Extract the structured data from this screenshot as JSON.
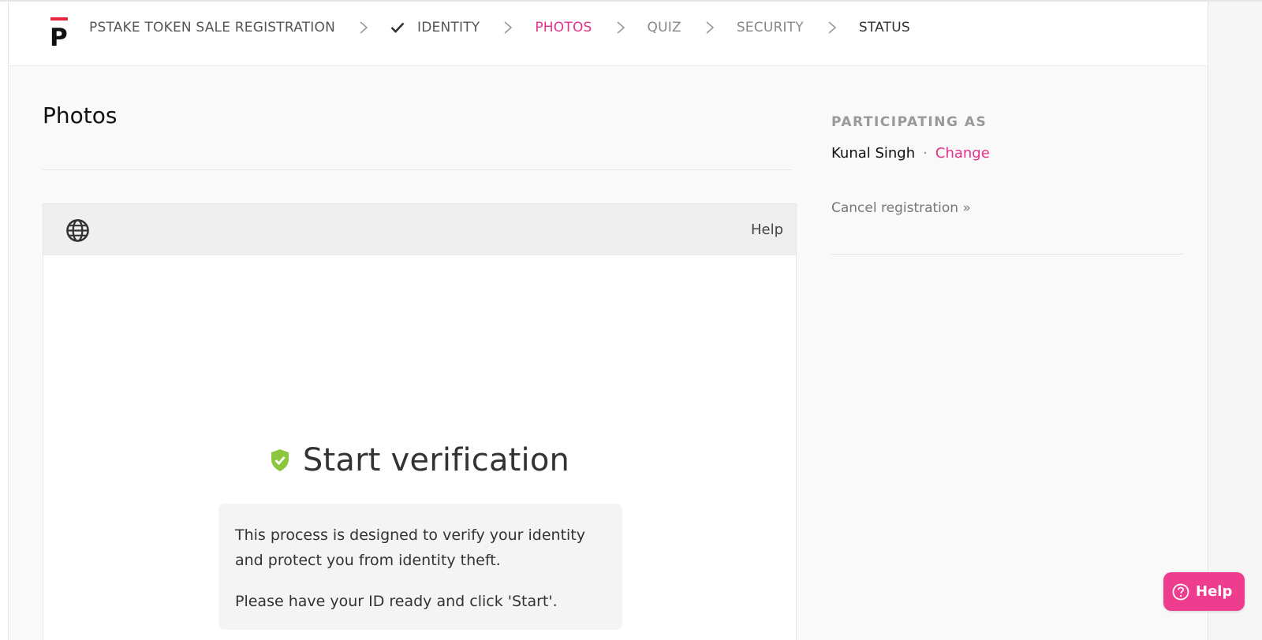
{
  "header": {
    "brand_letter": "P",
    "steps": [
      {
        "label": "PSTAKE TOKEN SALE REGISTRATION"
      },
      {
        "label": "IDENTITY",
        "completed": true
      },
      {
        "label": "PHOTOS",
        "active": true
      },
      {
        "label": "QUIZ"
      },
      {
        "label": "SECURITY"
      },
      {
        "label": "STATUS"
      }
    ]
  },
  "main": {
    "title": "Photos",
    "widget": {
      "language_icon": "globe-icon",
      "help_label": "Help",
      "heading": "Start verification",
      "heading_icon": "shield-check-icon",
      "body_line_1": "This process is designed to verify your identity and protect you from identity theft.",
      "body_line_2": "Please have your ID ready and click 'Start'."
    }
  },
  "sidebar": {
    "heading": "PARTICIPATING AS",
    "user_name": "Kunal Singh",
    "separator": "·",
    "change_label": "Change",
    "cancel_label": "Cancel registration »"
  },
  "help_fab": {
    "label": "Help",
    "icon": "question-circle-icon"
  },
  "colors": {
    "accent": "#e4308a",
    "fab": "#ee3c8e",
    "shield": "#8cc63f",
    "logo_bar": "#e8293c"
  }
}
